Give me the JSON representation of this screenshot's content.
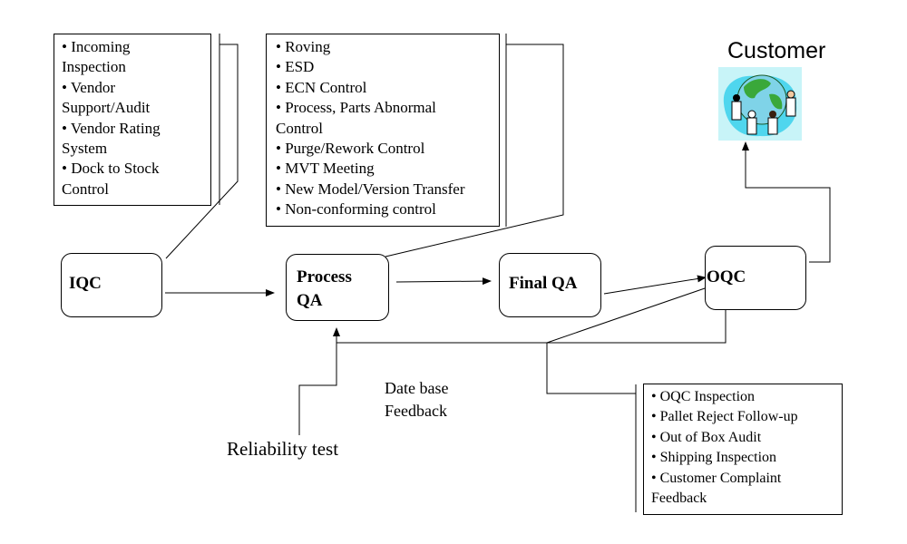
{
  "iqc_box": {
    "items": [
      "• Incoming",
      "Inspection",
      "• Vendor",
      "Support/Audit",
      "• Vendor Rating",
      "System",
      "• Dock to Stock",
      "Control"
    ]
  },
  "process_box": {
    "items": [
      "• Roving",
      "• ESD",
      "• ECN Control",
      "• Process, Parts Abnormal",
      "Control",
      "• Purge/Rework Control",
      "• MVT Meeting",
      "• New Model/Version Transfer",
      "• Non-conforming control"
    ]
  },
  "oqc_box": {
    "items": [
      "• OQC Inspection",
      "• Pallet Reject Follow-up",
      "• Out of Box Audit",
      "• Shipping Inspection",
      "• Customer Complaint",
      "Feedback"
    ]
  },
  "nodes": {
    "iqc": "IQC",
    "process_qa_1": "Process",
    "process_qa_2": "QA",
    "final_qa": "Final QA",
    "oqc": "OQC"
  },
  "customer": {
    "label": "Customer",
    "icon": "people-around-globe-icon"
  },
  "feedback": {
    "line1": "Date base",
    "line2": "Feedback"
  },
  "reliability": "Reliability test"
}
